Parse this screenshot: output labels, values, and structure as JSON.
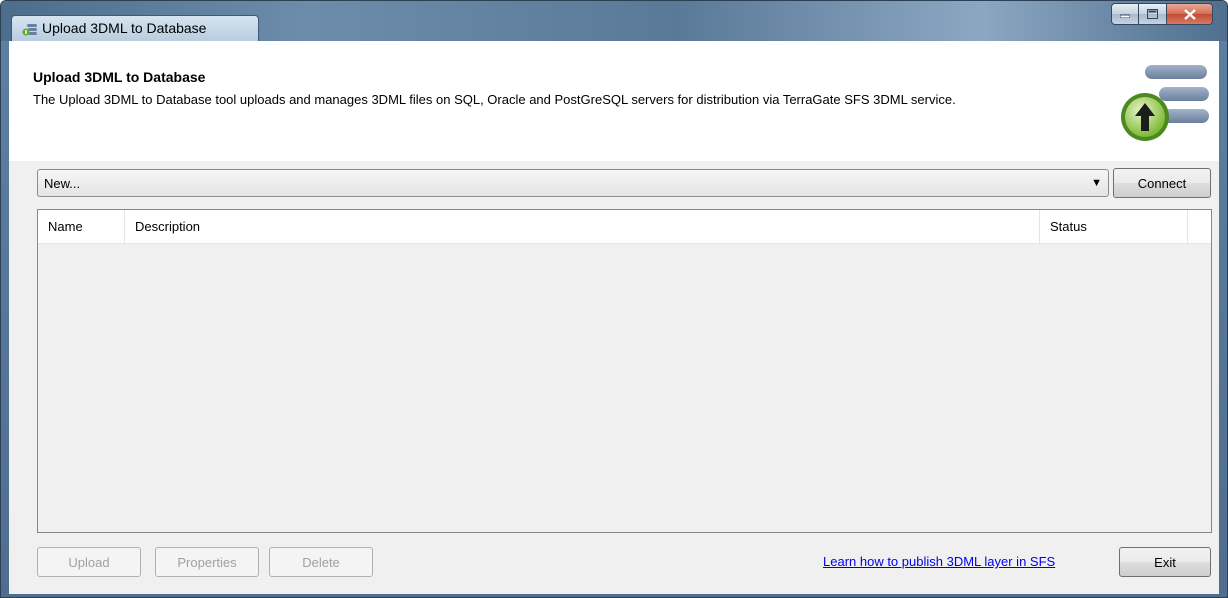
{
  "window": {
    "title": "Upload 3DML to Database"
  },
  "header": {
    "title": "Upload 3DML to Database",
    "description": "The Upload 3DML to Database tool uploads and manages 3DML files on SQL, Oracle and PostGreSQL servers for distribution via TerraGate SFS 3DML service.",
    "logo_icon": "upload-database-icon"
  },
  "connection": {
    "selected": "New...",
    "connect_label": "Connect"
  },
  "table": {
    "columns": [
      "Name",
      "Description",
      "Status"
    ],
    "rows": []
  },
  "footer": {
    "upload_label": "Upload",
    "properties_label": "Properties",
    "delete_label": "Delete",
    "help_link": "Learn how to publish 3DML layer in SFS",
    "exit_label": "Exit"
  },
  "colors": {
    "link": "#0000ee",
    "disabled_text": "#a0a0a0",
    "close_button": "#c24b33"
  }
}
